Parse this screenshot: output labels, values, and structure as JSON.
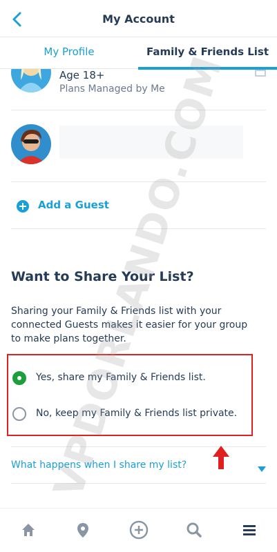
{
  "header": {
    "title": "My Account",
    "back_icon": "chevron-left-icon"
  },
  "tabs": [
    {
      "label": "My Profile",
      "active": false
    },
    {
      "label": "Family & Friends List",
      "active": true
    }
  ],
  "guests": [
    {
      "name": "Age 18+",
      "subtitle": "Plans Managed by Me",
      "avatar": "elsa-avatar"
    },
    {
      "name": "",
      "subtitle": "",
      "avatar": "mrs-incredible-avatar"
    }
  ],
  "add_guest": {
    "label": "Add a Guest",
    "icon": "plus-circle-icon"
  },
  "share": {
    "title": "Want to Share Your List?",
    "description": "Sharing your Family & Friends list with your connected Guests makes it easier for your group to make plans together.",
    "options": [
      {
        "label": "Yes, share my Family & Friends list.",
        "selected": true
      },
      {
        "label": "No, keep my Family & Friends list private.",
        "selected": false
      }
    ]
  },
  "faq": {
    "label": "What happens when I share my list?"
  },
  "watermark": "VPDORLANDO.COM",
  "bottom_nav": [
    "home-icon",
    "map-pin-icon",
    "plus-circle-icon",
    "search-icon",
    "menu-icon"
  ],
  "colors": {
    "accent": "#1a9fd6",
    "text": "#253b56",
    "selected": "#1e9e3a",
    "highlight": "#e02020"
  }
}
